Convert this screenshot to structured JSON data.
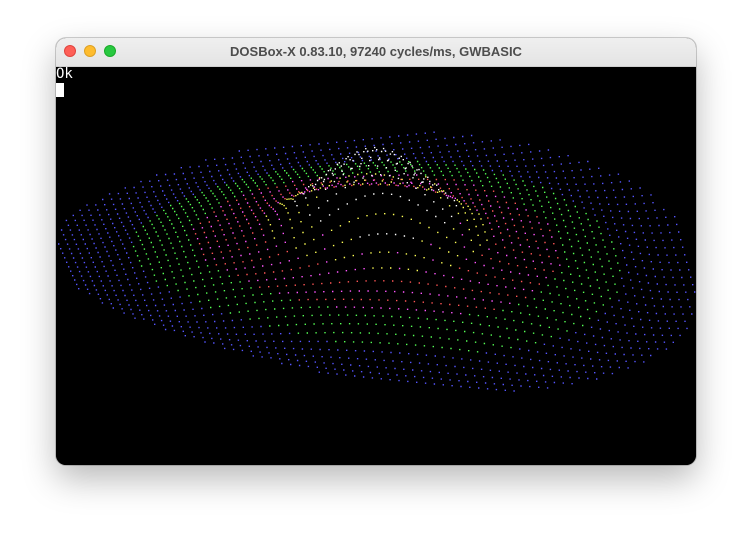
{
  "window": {
    "title": "DOSBox-X 0.83.10, 97240 cycles/ms, GWBASIC",
    "buttons": {
      "close": "close-icon",
      "minimize": "minimize-icon",
      "zoom": "zoom-icon"
    }
  },
  "screen": {
    "prompt": "Ok",
    "palette": {
      "background": "#000000",
      "text": "#ffffff",
      "blue": "#5555ff",
      "green": "#55ff55",
      "red": "#ff5555",
      "magenta": "#ff55ff",
      "yellow": "#ffff55",
      "white": "#ffffff"
    }
  }
}
